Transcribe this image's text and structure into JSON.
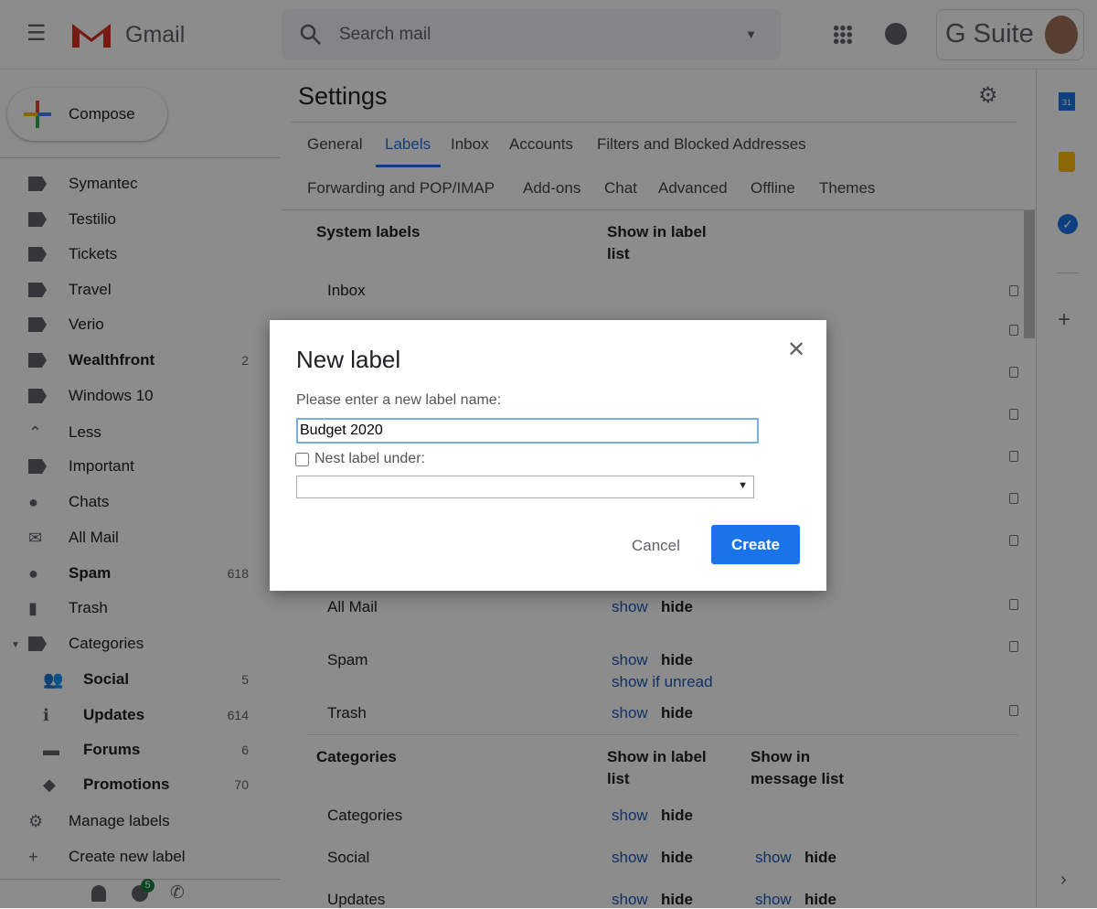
{
  "header": {
    "app_name": "Gmail",
    "search_placeholder": "Search mail",
    "gsuite": "G Suite"
  },
  "compose": "Compose",
  "sidebar": {
    "items": [
      {
        "label": "Symantec",
        "icon": "label-icon",
        "count": ""
      },
      {
        "label": "Testilio",
        "icon": "label-icon",
        "count": ""
      },
      {
        "label": "Tickets",
        "icon": "label-icon",
        "count": ""
      },
      {
        "label": "Travel",
        "icon": "label-icon",
        "count": ""
      },
      {
        "label": "Verio",
        "icon": "label-icon",
        "count": ""
      },
      {
        "label": "Wealthfront",
        "icon": "label-icon",
        "count": "2",
        "bold": true
      },
      {
        "label": "Windows 10",
        "icon": "label-icon",
        "count": ""
      },
      {
        "label": "Less",
        "icon": "chevron-up-icon",
        "count": ""
      },
      {
        "label": "Important",
        "icon": "important-icon",
        "count": ""
      },
      {
        "label": "Chats",
        "icon": "chat-icon",
        "count": ""
      },
      {
        "label": "All Mail",
        "icon": "mail-icon",
        "count": ""
      },
      {
        "label": "Spam",
        "icon": "spam-icon",
        "count": "618",
        "bold": true
      },
      {
        "label": "Trash",
        "icon": "trash-icon",
        "count": ""
      },
      {
        "label": "Categories",
        "icon": "label-icon",
        "count": ""
      },
      {
        "label": "Social",
        "icon": "people-icon",
        "count": "5",
        "bold": true,
        "sub": true
      },
      {
        "label": "Updates",
        "icon": "info-icon",
        "count": "614",
        "bold": true,
        "sub": true
      },
      {
        "label": "Forums",
        "icon": "forum-icon",
        "count": "6",
        "bold": true,
        "sub": true
      },
      {
        "label": "Promotions",
        "icon": "tag-icon",
        "count": "70",
        "bold": true,
        "sub": true
      },
      {
        "label": "Manage labels",
        "icon": "gear-icon",
        "count": ""
      },
      {
        "label": "Create new label",
        "icon": "plus-icon",
        "count": ""
      }
    ],
    "hangouts_badge": "5"
  },
  "settings": {
    "title": "Settings",
    "tabs_row1": [
      "General",
      "Labels",
      "Inbox",
      "Accounts",
      "Filters and Blocked Addresses"
    ],
    "tabs_row2": [
      "Forwarding and POP/IMAP",
      "Add-ons",
      "Chat",
      "Advanced",
      "Offline",
      "Themes"
    ],
    "active_tab": "Labels",
    "system_header": "System labels",
    "show_in_label_list": "Show in label list",
    "system_rows": [
      {
        "name": "Inbox"
      },
      {
        "name": "All Mail",
        "show": "show",
        "hide": "hide"
      },
      {
        "name": "Spam",
        "show": "show",
        "hide": "hide",
        "extra": "show if unread"
      },
      {
        "name": "Trash",
        "show": "show",
        "hide": "hide"
      }
    ],
    "categories_header": "Categories",
    "show_in_message_list": "Show in message list",
    "category_rows": [
      {
        "name": "Categories",
        "show": "show",
        "hide": "hide"
      },
      {
        "name": "Social",
        "show": "show",
        "hide": "hide",
        "mshow": "show",
        "mhide": "hide"
      },
      {
        "name": "Updates",
        "show": "show",
        "hide": "hide",
        "mshow": "show",
        "mhide": "hide"
      }
    ]
  },
  "dialog": {
    "title": "New label",
    "prompt": "Please enter a new label name:",
    "value": "Budget 2020",
    "nest_label": "Nest label under:",
    "nest_checked": false,
    "nest_value": "",
    "cancel": "Cancel",
    "create": "Create",
    "accent": "#1a73e8"
  }
}
